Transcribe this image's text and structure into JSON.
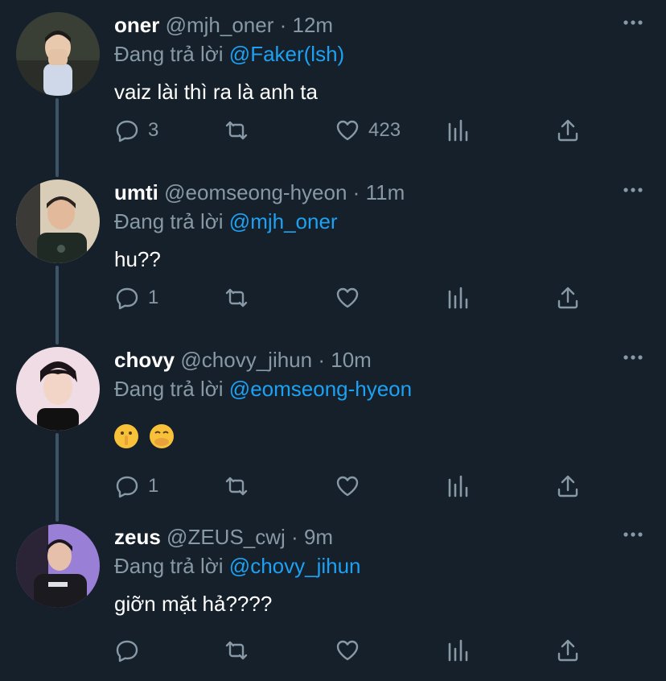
{
  "reply_prefix": "Đang trả lời",
  "tweets": [
    {
      "name": "oner",
      "handle": "@mjh_oner",
      "time": "12m",
      "reply_to": "@Faker(lsh)",
      "text": "vaiz lài thì ra là anh ta",
      "replies": "3",
      "retweets": "",
      "likes": "423",
      "avatar_bg": "#3a3f36"
    },
    {
      "name": "umti",
      "handle": "@eomseong-hyeon",
      "time": "11m",
      "reply_to": "@mjh_oner",
      "text": "hu??",
      "replies": "1",
      "retweets": "",
      "likes": "",
      "avatar_bg": "#d9cdb8"
    },
    {
      "name": "chovy",
      "handle": "@chovy_jihun",
      "time": "10m",
      "reply_to": "@eomseong-hyeon",
      "text": "",
      "emojis": [
        "shushing-face-emoji",
        "hand-over-mouth-emoji"
      ],
      "replies": "1",
      "retweets": "",
      "likes": "",
      "avatar_bg": "#f0dce4"
    },
    {
      "name": "zeus",
      "handle": "@ZEUS_cwj",
      "time": "9m",
      "reply_to": "@chovy_jihun",
      "text": "giỡn mặt hả????",
      "replies": "",
      "retweets": "",
      "likes": "",
      "avatar_bg": "#9a7fd6"
    }
  ],
  "colors": {
    "background": "#15202b",
    "secondary_text": "#8899a6",
    "mention": "#1da1f2",
    "thread_line": "#3d5466"
  }
}
